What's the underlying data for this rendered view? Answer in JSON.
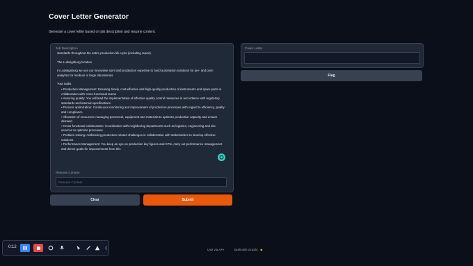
{
  "header": {
    "title": "Cover Letter Generator",
    "subtitle": "Generate a cover letter based on job description and resume content."
  },
  "job_description": {
    "label": "Job Description",
    "paragraphs": [
      "standards throughout the entire production life cycle (including repair).",
      "The Ludwigsburg location",
      "In Ludwigsburg we use our innovative spirit and production expertise to build automation solutions for pre- and post-analytics for medium to large laboratories.",
      "Your tasks"
    ],
    "tasks": [
      "• Production Management: Ensuring timely, cost-effective and high-quality production of instruments and spare parts in collaboration with cross-functional teams",
      "• Assuring quality: You will lead the implementation of effective quality control measures in accordance with regulatory standards and internal specifications",
      "• Process optimization: Continuous monitoring and improvement of production processes with regard to efficiency, quality and compliance",
      "• Allocation of resources: managing personnel, equipment and materials to optimize production capacity and ensure demand",
      "• Cross-functional collaboration: Coordination with neighboring departments such as logistics, engineering and site services to optimize processes",
      "• Problem solving: Addressing production-related challenges in collaboration with stakeholders to develop effective solutions",
      "• Performance Management: You keep an eye on production key figures and KPIs, carry out performance management and derive goals for improvements from this"
    ]
  },
  "resume": {
    "label": "Resume Content",
    "placeholder": "Resume Content"
  },
  "buttons": {
    "clear": "Clear",
    "submit": "Submit",
    "flag": "Flag"
  },
  "cover_letter": {
    "label": "Cover Letter",
    "value": ""
  },
  "footer": {
    "api": "Use via API",
    "built": "Built with Gradio"
  },
  "recorder": {
    "time": "0:12"
  },
  "colors": {
    "accent": "#ea580c",
    "background": "#0b0f19",
    "panel": "#1f2937"
  }
}
